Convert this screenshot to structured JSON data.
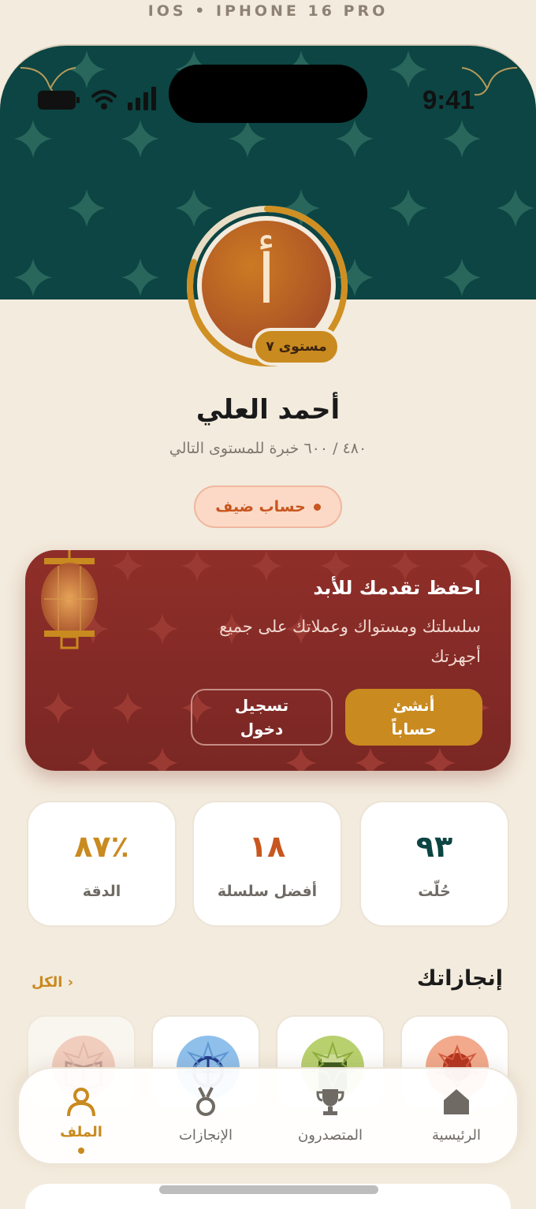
{
  "device_label": "IOS • IPHONE 16 PRO",
  "status_bar": {
    "time": "9:41"
  },
  "colors": {
    "hero": "#0c4543",
    "accent": "#c98a1f",
    "card": "#8f2e29",
    "streak": "#c8561f",
    "solved": "#0c4543"
  },
  "profile": {
    "avatar_letter": "أ",
    "level_badge": "مستوى ٧",
    "name": "أحمد العلي",
    "xp_text": "٤٨٠ / ٦٠٠ خبرة للمستوى التالي",
    "xp_progress": 0.8,
    "guest_badge": "حساب ضيف"
  },
  "save_card": {
    "title": "احفظ تقدمك للأبد",
    "description": "سلسلتك ومستواك وعملاتك على جميع أجهزتك",
    "create_button": "أنشئ\nحساباً",
    "login_button": "تسجيل\nدخول",
    "icon": "lantern-icon"
  },
  "stats": [
    {
      "value": "٩٣",
      "label": "حُلّت"
    },
    {
      "value": "١٨",
      "label": "أفضل سلسلة"
    },
    {
      "value": "٨٧٪",
      "label": "الدقة"
    }
  ],
  "achievements": {
    "title": "إنجازاتك",
    "see_all": "الكل ›",
    "badges": [
      {
        "icon": "geometric-badge-icon",
        "color": "#f2a98c"
      },
      {
        "icon": "scroll-badge-icon",
        "color": "#b8d06e"
      },
      {
        "icon": "globe-badge-icon",
        "color": "#8fc0ec"
      },
      {
        "icon": "book-badge-icon",
        "color": "#f0b6a6"
      }
    ]
  },
  "tabbar": {
    "tabs": [
      {
        "label": "الرئيسية",
        "icon": "home-icon"
      },
      {
        "label": "المتصدرون",
        "icon": "trophy-icon"
      },
      {
        "label": "الإنجازات",
        "icon": "medal-icon"
      },
      {
        "label": "الملف",
        "icon": "person-icon",
        "active": true
      }
    ]
  }
}
